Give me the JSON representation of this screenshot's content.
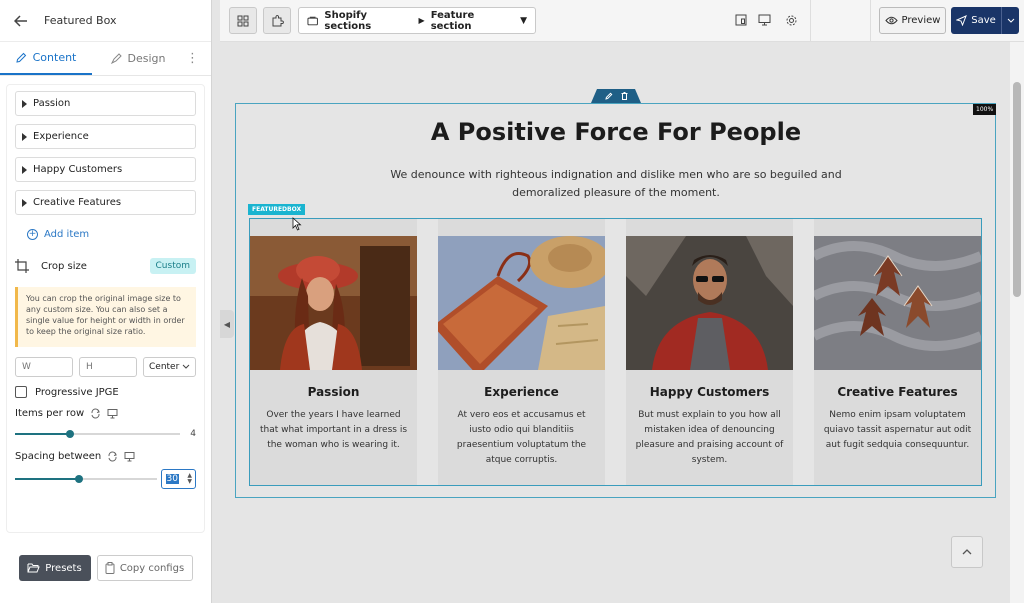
{
  "panel": {
    "title": "Featured Box",
    "tabs": [
      {
        "label": "Content"
      },
      {
        "label": "Design"
      }
    ],
    "items": [
      {
        "label": "Passion"
      },
      {
        "label": "Experience"
      },
      {
        "label": "Happy Customers"
      },
      {
        "label": "Creative Features"
      }
    ],
    "add_item": "Add item",
    "crop": {
      "label": "Crop size",
      "badge": "Custom"
    },
    "info": "You can crop the original image size to any custom size. You can also set a single value for height or width in order to keep the original size ratio.",
    "width_placeholder": "W",
    "height_placeholder": "H",
    "align_value": "Center",
    "progressive_label": "Progressive JPGE",
    "items_per_row": {
      "label": "Items per row",
      "value": "4",
      "fraction": 0.33
    },
    "spacing": {
      "label": "Spacing between",
      "value": "30",
      "fraction": 0.45
    },
    "presets": "Presets",
    "copy_configs": "Copy configs"
  },
  "topbar": {
    "breadcrumb_root": "Shopify sections",
    "breadcrumb_current": "Feature section",
    "preview": "Preview",
    "save": "Save"
  },
  "canvas": {
    "zoom": "100%",
    "title": "A Positive Force For People",
    "description": "We denounce with righteous indignation and dislike men who are so beguiled and demoralized pleasure of the moment.",
    "element_label": "FEATUREDBOX",
    "cards": [
      {
        "title": "Passion",
        "text": "Over the years I have learned that what important in a dress is the woman who is wearing it."
      },
      {
        "title": "Experience",
        "text": "At vero eos et accusamus et iusto odio qui blanditiis praesentium voluptatum the atque corruptis."
      },
      {
        "title": "Happy Customers",
        "text": "But must explain to you how all mistaken idea of denouncing pleasure and praising account of system."
      },
      {
        "title": "Creative Features",
        "text": "Nemo enim ipsam voluptatem quiavo tassit aspernatur aut odit aut fugit sedquia consequuntur."
      }
    ]
  },
  "colors": {
    "accent": "#1a73c8",
    "save": "#1a3568",
    "outline": "#3a9cbc",
    "badge": "#1ab4d0"
  }
}
